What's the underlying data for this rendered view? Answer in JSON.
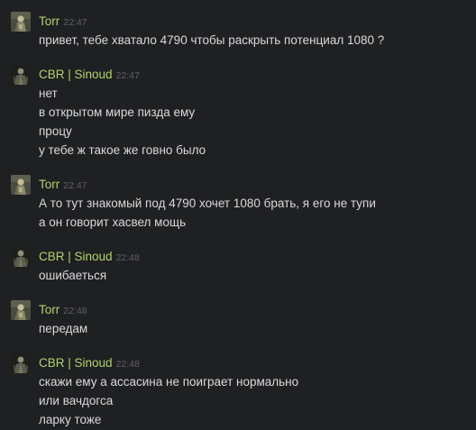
{
  "messages": [
    {
      "sender": "Torr",
      "time": "22:47",
      "avatar": "torr-avatar",
      "lines": [
        "привет, тебе хватало 4790 чтобы раскрыть потенциал 1080 ?"
      ]
    },
    {
      "sender": "CBR | Sinoud",
      "time": "22:47",
      "avatar": "sinoud-avatar",
      "lines": [
        "нет",
        "в открытом мире пизда ему",
        "процу",
        "у тебе ж такое же говно было"
      ]
    },
    {
      "sender": "Torr",
      "time": "22:47",
      "avatar": "torr-avatar",
      "lines": [
        "А то тут знакомый под 4790 хочет 1080 брать, я его не тупи",
        "а он говорит хасвел мощь"
      ]
    },
    {
      "sender": "CBR | Sinoud",
      "time": "22:48",
      "avatar": "sinoud-avatar",
      "lines": [
        "ошибаеться"
      ]
    },
    {
      "sender": "Torr",
      "time": "22:48",
      "avatar": "torr-avatar",
      "lines": [
        "передам"
      ]
    },
    {
      "sender": "CBR | Sinoud",
      "time": "22:48",
      "avatar": "sinoud-avatar",
      "lines": [
        "скажи ему а ассасина не поиграет нормально",
        "или вачдогса",
        "ларку тоже"
      ]
    }
  ],
  "colors": {
    "background": "#1f2022",
    "sender_name": "#b3d46a",
    "timestamp": "#5f6166",
    "message_text": "#d9dadb"
  }
}
